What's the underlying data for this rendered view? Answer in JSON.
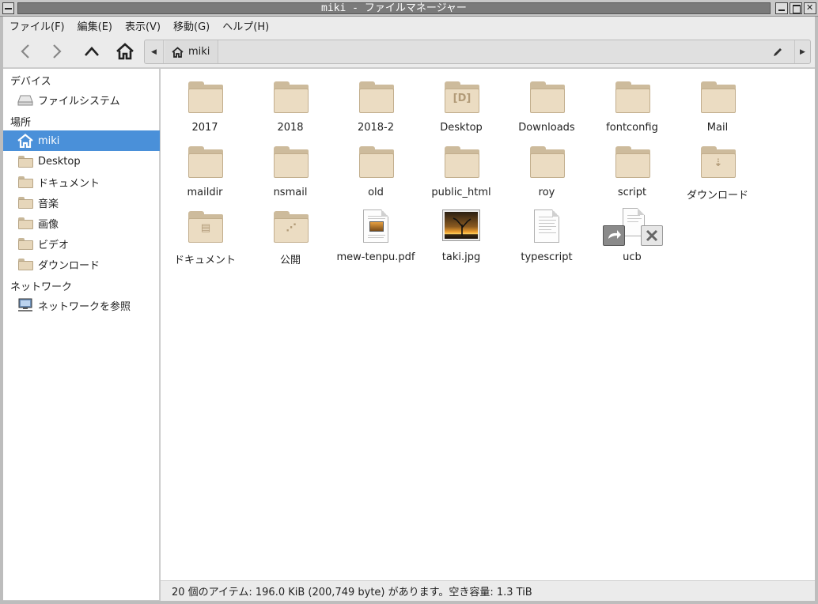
{
  "window": {
    "title": "miki - ファイルマネージャー"
  },
  "menu": [
    "ファイル(F)",
    "編集(E)",
    "表示(V)",
    "移動(G)",
    "ヘルプ(H)"
  ],
  "location": {
    "current": "miki"
  },
  "sidebar": {
    "sections": [
      {
        "header": "デバイス",
        "items": [
          {
            "label": "ファイルシステム",
            "icon": "drive-icon",
            "selected": false
          }
        ]
      },
      {
        "header": "場所",
        "items": [
          {
            "label": "miki",
            "icon": "home-icon",
            "selected": true
          },
          {
            "label": "Desktop",
            "icon": "folder-desktop-icon",
            "selected": false
          },
          {
            "label": "ドキュメント",
            "icon": "folder-documents-icon",
            "selected": false
          },
          {
            "label": "音楽",
            "icon": "folder-music-icon",
            "selected": false
          },
          {
            "label": "画像",
            "icon": "folder-pictures-icon",
            "selected": false
          },
          {
            "label": "ビデオ",
            "icon": "folder-videos-icon",
            "selected": false
          },
          {
            "label": "ダウンロード",
            "icon": "folder-download-icon",
            "selected": false
          }
        ]
      },
      {
        "header": "ネットワーク",
        "items": [
          {
            "label": "ネットワークを参照",
            "icon": "network-icon",
            "selected": false
          }
        ]
      }
    ]
  },
  "files": [
    {
      "name": "2017",
      "type": "folder"
    },
    {
      "name": "2018",
      "type": "folder"
    },
    {
      "name": "2018-2",
      "type": "folder"
    },
    {
      "name": "Desktop",
      "type": "folder-desktop"
    },
    {
      "name": "Downloads",
      "type": "folder"
    },
    {
      "name": "fontconfig",
      "type": "folder"
    },
    {
      "name": "Mail",
      "type": "folder"
    },
    {
      "name": "maildir",
      "type": "folder"
    },
    {
      "name": "nsmail",
      "type": "folder"
    },
    {
      "name": "old",
      "type": "folder"
    },
    {
      "name": "public_html",
      "type": "folder"
    },
    {
      "name": "roy",
      "type": "folder"
    },
    {
      "name": "script",
      "type": "folder"
    },
    {
      "name": "ダウンロード",
      "type": "folder-download"
    },
    {
      "name": "ドキュメント",
      "type": "folder-documents"
    },
    {
      "name": "公開",
      "type": "folder-public"
    },
    {
      "name": "mew-tenpu.pdf",
      "type": "pdf"
    },
    {
      "name": "taki.jpg",
      "type": "image"
    },
    {
      "name": "typescript",
      "type": "text"
    },
    {
      "name": "ucb",
      "type": "broken-link"
    }
  ],
  "status": "20 個のアイテム: 196.0 KiB (200,749 byte) があります。空き容量: 1.3 TiB",
  "colors": {
    "selection": "#4a90d9",
    "folder": "#ebdcc2"
  }
}
